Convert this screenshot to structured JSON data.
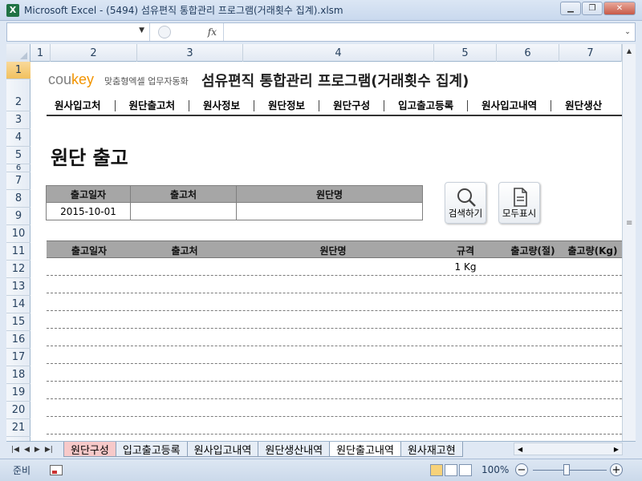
{
  "window": {
    "app_icon": "X",
    "title": "Microsoft Excel - (5494) 섬유편직 통합관리 프로그램(거래횟수 집계).xlsm",
    "minimize": "▭",
    "restore": "▣",
    "close": "X"
  },
  "formula_bar": {
    "fx": "fx",
    "name_value": "",
    "formula_value": ""
  },
  "columns": [
    "1",
    "2",
    "3",
    "4",
    "5",
    "6",
    "7"
  ],
  "rows": [
    "1",
    "2",
    "3",
    "4",
    "5",
    "6",
    "7",
    "8",
    "9",
    "10",
    "11",
    "12",
    "13",
    "14",
    "15",
    "16",
    "17",
    "18",
    "19",
    "20",
    "21"
  ],
  "header": {
    "logo_co": "cou",
    "logo_key": "key",
    "slogan": "맞춤형엑셀 업무자동화",
    "title": "섬유편직 통합관리 프로그램(거래횟수 집계)"
  },
  "nav": [
    "원사입고처",
    "원단출고처",
    "원사정보",
    "원단정보",
    "원단구성",
    "입고출고등록",
    "원사입고내역",
    "원단생산"
  ],
  "page_heading": "원단 출고",
  "search_form": {
    "headers": [
      "출고일자",
      "출고처",
      "원단명"
    ],
    "values": [
      "2015-10-01",
      "",
      ""
    ]
  },
  "buttons": {
    "search": "검색하기",
    "show_all": "모두표시"
  },
  "list": {
    "headers": [
      "출고일자",
      "출고처",
      "원단명",
      "규격",
      "출고량(절)",
      "출고량(Kg)"
    ],
    "rows": [
      [
        "",
        "",
        "",
        "1 Kg",
        "",
        ""
      ],
      [
        "",
        "",
        "",
        "",
        "",
        ""
      ],
      [
        "",
        "",
        "",
        "",
        "",
        ""
      ],
      [
        "",
        "",
        "",
        "",
        "",
        ""
      ],
      [
        "",
        "",
        "",
        "",
        "",
        ""
      ],
      [
        "",
        "",
        "",
        "",
        "",
        ""
      ],
      [
        "",
        "",
        "",
        "",
        "",
        ""
      ],
      [
        "",
        "",
        "",
        "",
        "",
        ""
      ],
      [
        "",
        "",
        "",
        "",
        "",
        ""
      ],
      [
        "",
        "",
        "",
        "",
        "",
        ""
      ]
    ]
  },
  "sheet_tabs": [
    {
      "label": "원단구성",
      "style": "red"
    },
    {
      "label": "입고출고등록",
      "style": "normal"
    },
    {
      "label": "원사입고내역",
      "style": "normal"
    },
    {
      "label": "원단생산내역",
      "style": "normal"
    },
    {
      "label": "원단출고내역",
      "style": "active"
    },
    {
      "label": "원사재고현",
      "style": "normal"
    }
  ],
  "status": {
    "ready": "준비",
    "zoom": "100%"
  }
}
